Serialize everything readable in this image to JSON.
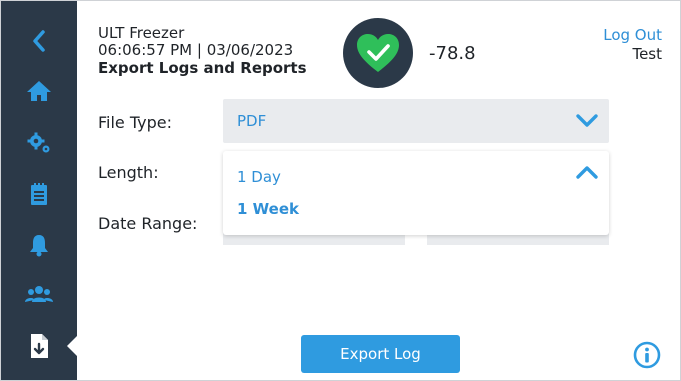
{
  "header": {
    "device_name": "ULT Freezer",
    "datetime": "06:06:57 PM | 03/06/2023",
    "page_title": "Export Logs and Reports",
    "temperature": "-78.8",
    "logout_label": "Log Out",
    "user_name": "Test"
  },
  "form": {
    "file_type_label": "File Type:",
    "file_type_value": "PDF",
    "length_label": "Length:",
    "date_range_label": "Date Range:",
    "length_options": [
      "1 Day",
      "1 Week"
    ]
  },
  "actions": {
    "export_label": "Export Log"
  },
  "colors": {
    "sidebar": "#2b3948",
    "accent": "#2f8fd6",
    "status_ok": "#2fbf5a"
  },
  "icons": {
    "sidebar": [
      "back-icon",
      "home-icon",
      "settings-icon",
      "logs-icon",
      "alarm-icon",
      "users-icon",
      "export-file-icon"
    ],
    "status": "heart-check-icon",
    "info": "info-icon"
  }
}
